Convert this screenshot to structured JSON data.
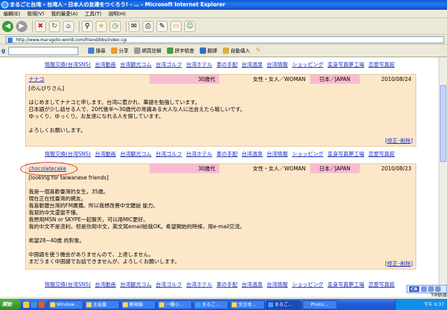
{
  "window": {
    "title": "まるごと台湾 - 台湾人・日本人の友達をつくろう! - … - Microsoft Internet Explorer"
  },
  "menu": [
    "編輯(E)",
    "檢視(V)",
    "我的最愛(A)",
    "工具(T)",
    "說明(H)"
  ],
  "address": {
    "url": "http://www.marugoto-world.com/friend/bbs/index.cgi"
  },
  "google_toolbar": {
    "buttons": [
      "搜尋",
      "分享",
      "網頁註解",
      "拼字檢查",
      "翻譯",
      "自動填入"
    ]
  },
  "nav": [
    "情報交換(台湾SNS)",
    "台湾動画",
    "台湾観光コム",
    "台湾ゴルフ",
    "台湾ホテル",
    "車の手配",
    "台湾温泉",
    "台湾情報",
    "ショッピング",
    "変身写真夢工場",
    "恋愛写真館"
  ],
  "entries": [
    {
      "name": "ナナコ",
      "age": "30歳代",
      "sex": "女性・女人／WOMAN",
      "country": "日本／JAPAN",
      "date": "2010/08/24",
      "lines": [
        "[のんびりさん]",
        "",
        "はじめましてナナコと申します。台湾に惹かれ、華語を勉強しています。",
        "日本語が少し話せる人で、20代後半～30歳代の常識ある大人な人に出会えたら嬉しいです。",
        "ゆっくり、ゆっくり。お友達になれる人を探しています。",
        "",
        "よろしくお願いします。"
      ],
      "edit": "修正･削除"
    },
    {
      "name": "chocolatecake",
      "age": "30歳代",
      "sex": "女性・女人／WOMAN",
      "country": "日本／JAPAN",
      "date": "2010/08/23",
      "lines": [
        "[looking for taiwanese friends]",
        "",
        "我是一個喜歡臺灣的女生。35歲。",
        "現在正在找臺灣的網友。",
        "我喜歡聽台灣的FM廣播。所以我想改善中文聽說 能力。",
        "我寫的中文還蠻不懂。",
        "我想用MSN or SKYPE一起聊天，可以用MIC更好。",
        "我的中文不是流利，但是你用中文，英文寫email給我OK。希望開始的時候，用e-mail交流。",
        "",
        "希望28~40歲 的對象。",
        "",
        "中国語を使う機会がありませんので、上達しません。",
        "まだうまく中国語でお話できませんが、よろしくお願いします。"
      ],
      "edit": "修正･削除"
    }
  ],
  "langbar": {
    "code": "CB"
  },
  "tooltip": "下吧的資",
  "taskbar": {
    "start": "開始",
    "tasks": [
      "Window...",
      "主音量",
      "郵寫稿",
      "一種小...",
      "まるご...",
      "文日本...",
      "まるご...",
      "Photo..."
    ],
    "clock": "下午 0:37"
  },
  "colors": {
    "entry_bg": "#fde7c9",
    "entry_pink": "#f8bcd2",
    "link": "#1a2fbf",
    "highlight_circle": "#d02a2a"
  }
}
